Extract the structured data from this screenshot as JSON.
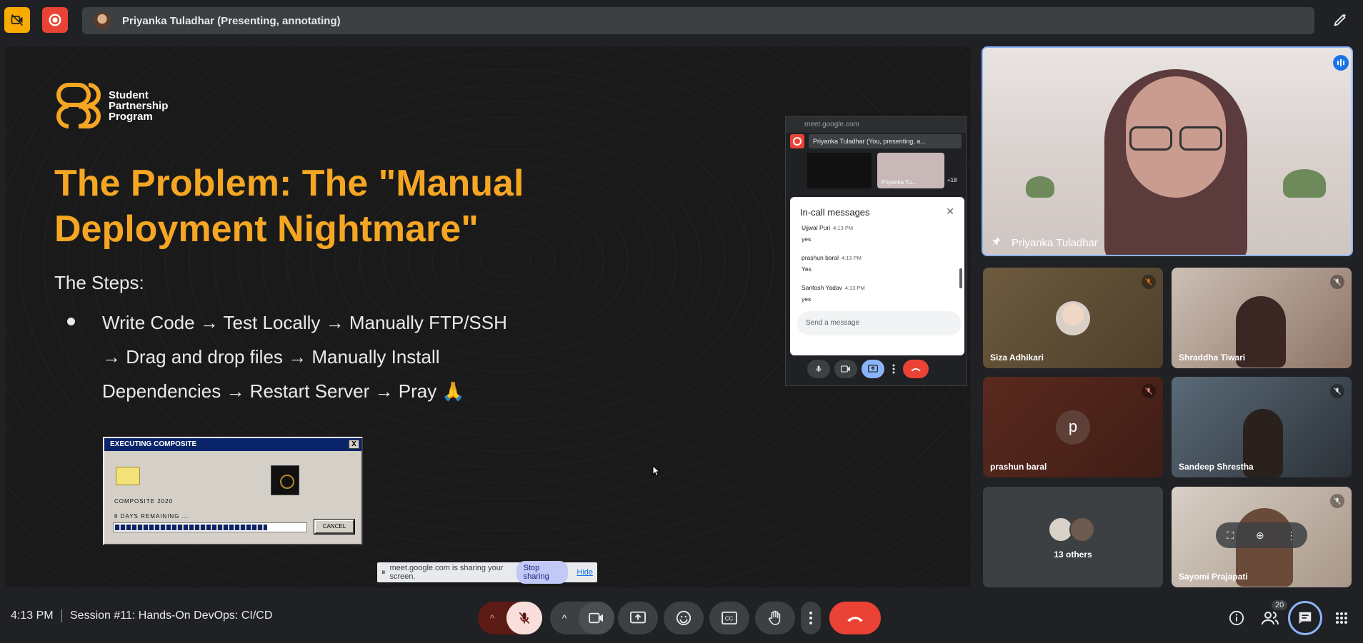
{
  "top": {
    "presenter_label": "Priyanka Tuladhar (Presenting, annotating)"
  },
  "slide": {
    "logo_line1": "Student",
    "logo_line2": "Partnership",
    "logo_line3": "Program",
    "title_line1": "The Problem: The \"Manual",
    "title_line2": "Deployment Nightmare\"",
    "subtitle": "The Steps:",
    "bullet_line1": "Write Code → Test Locally → Manually FTP/SSH",
    "bullet_line2": "→ Drag and drop files → Manually Install",
    "bullet_line3": "Dependencies → Restart Server → Pray 🙏",
    "popup": {
      "title": "EXECUTING COMPOSITE",
      "close": "X",
      "composite": "COMPOSITE 2020",
      "days": "6 DAYS REMAINING ...",
      "progress": 0.8,
      "cancel": "CANCEL"
    }
  },
  "share_bar": {
    "message": "meet.google.com is sharing your screen.",
    "stop": "Stop sharing",
    "hide": "Hide"
  },
  "mini_window": {
    "url": "meet.google.com",
    "presenter_label": "Priyanka Tuladhar (You, presenting, a...",
    "thumb_name": "Priyanka Tu...",
    "thumb_count": "+18",
    "chat_title": "In-call messages",
    "messages": [
      {
        "who": "Ujjwal Puri",
        "time": "4:13 PM",
        "text": "yes"
      },
      {
        "who": "prashun baral",
        "time": "4:13 PM",
        "text": "Yes"
      },
      {
        "who": "Santosh Yadav",
        "time": "4:13 PM",
        "text": "yes"
      }
    ],
    "input_placeholder": "Send a message"
  },
  "tiles": {
    "main": "Priyanka Tuladhar",
    "t1": "Siza Adhikari",
    "t2": "Shraddha Tiwari",
    "t3": "prashun baral",
    "t3_initial": "p",
    "t4": "Sandeep Shrestha",
    "t5": "13 others",
    "t6": "Sayomi Prajapati"
  },
  "bottom": {
    "time": "4:13 PM",
    "session": "Session #11: Hands-On DevOps: CI/CD",
    "people_count": "20"
  },
  "colors": {
    "accent_orange": "#f5a623",
    "end_call_red": "#ea4335",
    "mic_off_bg": "#f9dedc"
  }
}
